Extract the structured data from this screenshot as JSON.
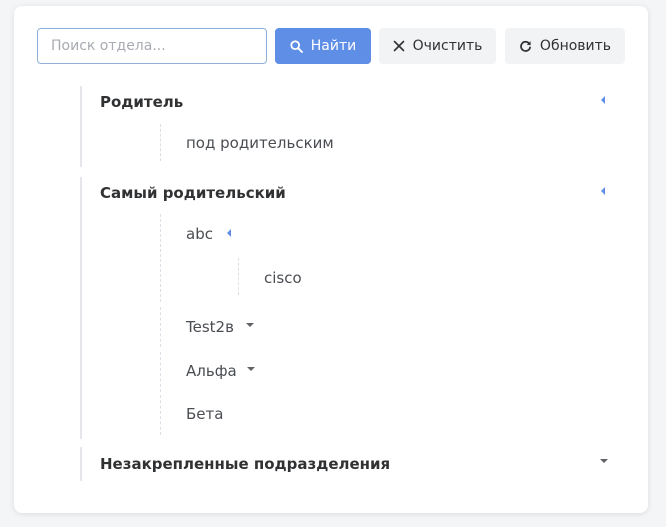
{
  "search": {
    "placeholder": "Поиск отдела...",
    "value": "",
    "find_label": "Найти",
    "clear_label": "Очистить",
    "refresh_label": "Обновить"
  },
  "tree": [
    {
      "label": "Родитель",
      "expanded": true,
      "children": [
        {
          "label": "под родительским"
        }
      ]
    },
    {
      "label": "Самый родительский",
      "expanded": true,
      "children": [
        {
          "label": "abc",
          "expanded": true,
          "children": [
            {
              "label": "cisco"
            }
          ]
        },
        {
          "label": "Test2в",
          "expanded": false
        },
        {
          "label": "Альфа",
          "expanded": false
        },
        {
          "label": "Бета"
        }
      ]
    },
    {
      "label": "Незакрепленные подразделения",
      "expanded": false
    }
  ],
  "icons": {
    "find": "search-icon",
    "clear": "close-icon",
    "refresh": "refresh-icon",
    "expanded": "caret-left-icon",
    "collapsed": "caret-down-icon"
  },
  "colors": {
    "primary": "#5f8ee6",
    "button_bg": "#f2f3f5",
    "tree_line": "#e4e6ea"
  }
}
